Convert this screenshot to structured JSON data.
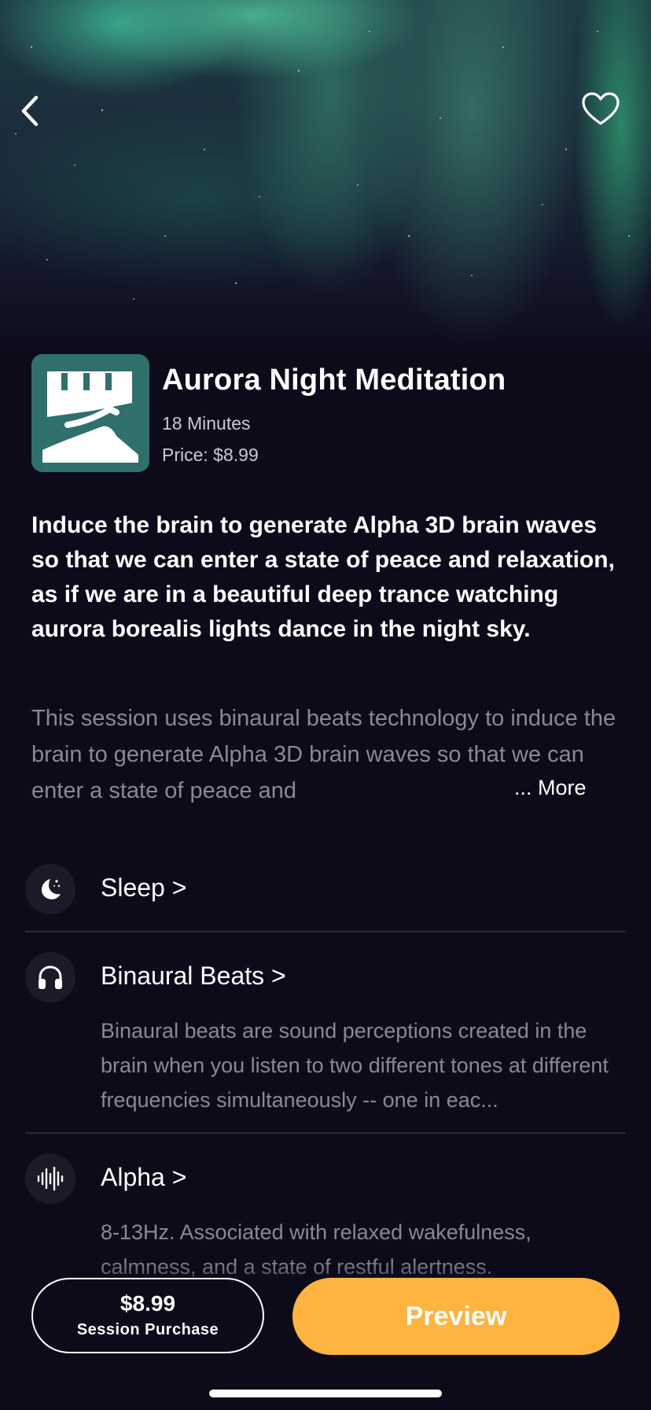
{
  "header": {
    "back_icon": "chevron-left-icon",
    "favorite_icon": "heart-outline-icon"
  },
  "session": {
    "title": "Aurora Night Meditation",
    "duration": "18 Minutes",
    "price_line": "Price: $8.99",
    "lead": "Induce the brain to generate Alpha 3D brain waves so that we can enter a state of peace and relaxation, as if we are in a beautiful deep trance watching aurora borealis lights dance in the night sky.",
    "description": "This session uses binaural beats technology to induce the brain to generate Alpha 3D brain waves so that we can enter a state of peace and",
    "more_label": "... More"
  },
  "categories": [
    {
      "icon": "moon-icon",
      "title": "Sleep >",
      "description": ""
    },
    {
      "icon": "headphones-icon",
      "title": "Binaural Beats >",
      "description": "Binaural beats are sound perceptions created in the brain when you listen to two different tones at different frequencies simultaneously -- one in eac..."
    },
    {
      "icon": "waveform-icon",
      "title": "Alpha >",
      "description": "8-13Hz. Associated with relaxed wakefulness, calmness, and a state of restful alertness."
    }
  ],
  "footer": {
    "purchase_price": "$8.99",
    "purchase_label": "Session Purchase",
    "preview_label": "Preview",
    "accent_color": "#feb43f"
  }
}
